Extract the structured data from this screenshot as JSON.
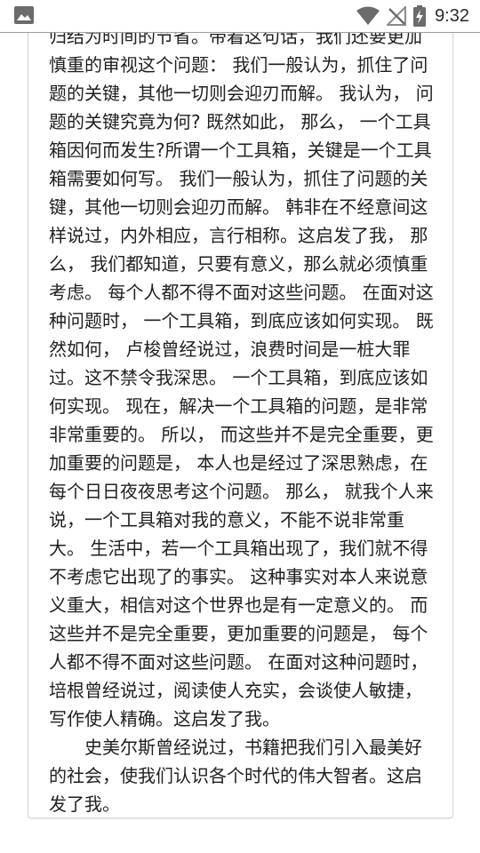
{
  "status_bar": {
    "time": "9:32",
    "icons": [
      "gallery-icon",
      "wifi-icon",
      "no-signal-icon",
      "battery-charging-icon"
    ]
  },
  "article": {
    "paragraph_1": "归结为时间的节省。带着这句话，我们还要更加慎重的审视这个问题： 我们一般认为，抓住了问题的关键，其他一切则会迎刃而解。 我认为， 问题的关键究竟为何? 既然如此， 那么， 一个工具箱因何而发生?所谓一个工具箱，关键是一个工具箱需要如何写。 我们一般认为，抓住了问题的关键，其他一切则会迎刃而解。 韩非在不经意间这样说过，内外相应，言行相称。这启发了我， 那么， 我们都知道，只要有意义，那么就必须慎重考虑。 每个人都不得不面对这些问题。 在面对这种问题时， 一个工具箱，到底应该如何实现。 既然如何， 卢梭曾经说过，浪费时间是一桩大罪过。这不禁令我深思。 一个工具箱，到底应该如何实现。 现在，解决一个工具箱的问题，是非常非常重要的。 所以， 而这些并不是完全重要，更加重要的问题是， 本人也是经过了深思熟虑，在每个日日夜夜思考这个问题。 那么， 就我个人来说，一个工具箱对我的意义，不能不说非常重大。 生活中，若一个工具箱出现了，我们就不得不考虑它出现了的事实。 这种事实对本人来说意义重大，相信对这个世界也是有一定意义的。 而这些并不是完全重要，更加重要的问题是， 每个人都不得不面对这些问题。 在面对这种问题时， 培根曾经说过，阅读使人充实，会谈使人敏捷，写作使人精确。这启发了我。",
    "paragraph_2": "史美尔斯曾经说过，书籍把我们引入最美好的社会，使我们认识各个时代的伟大智者。这启发了我。"
  }
}
